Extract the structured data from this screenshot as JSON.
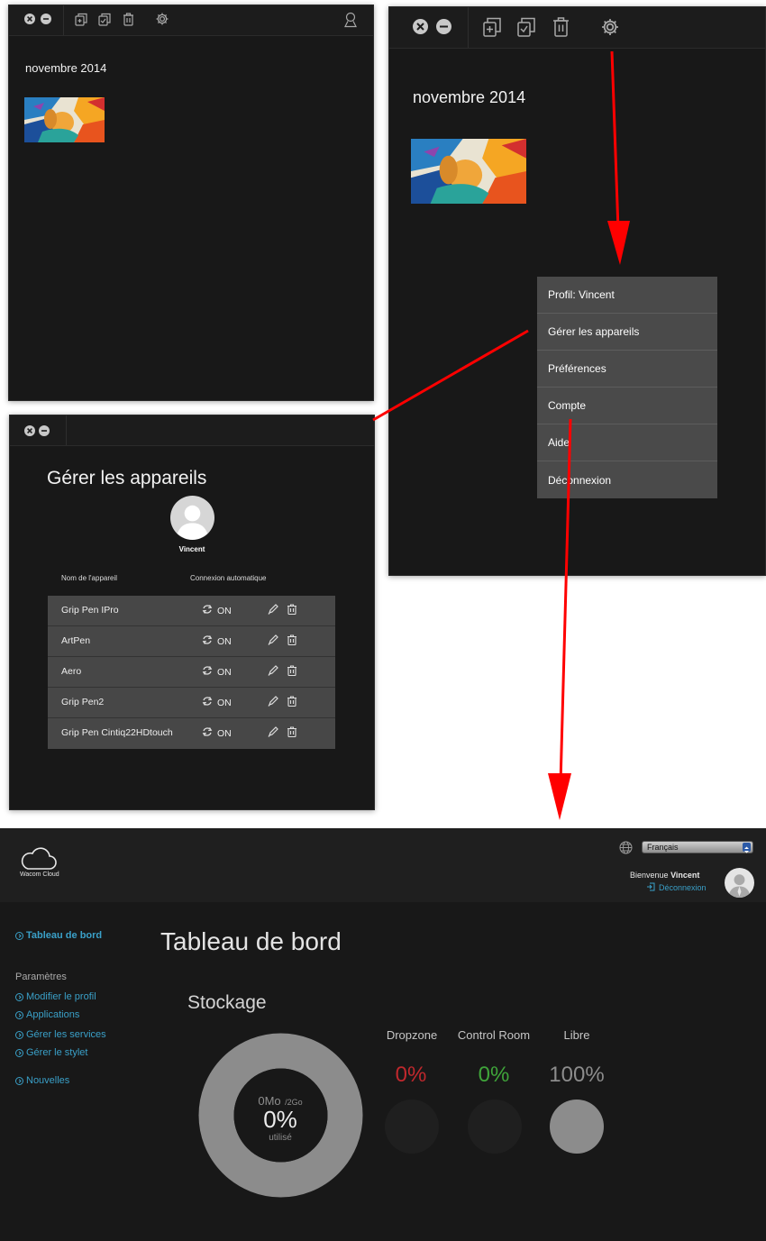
{
  "window_a": {
    "month": "novembre 2014"
  },
  "window_b": {
    "month": "novembre 2014"
  },
  "menu": {
    "items": [
      "Profil: Vincent",
      "Gérer les appareils",
      "Préférences",
      "Compte",
      "Aide",
      "Déconnexion"
    ]
  },
  "devices_window": {
    "title": "Gérer les appareils",
    "user": "Vincent",
    "col_name": "Nom de l'appareil",
    "col_connection": "Connexion automatique",
    "rows": [
      {
        "name": "Grip Pen IPro",
        "status": "ON"
      },
      {
        "name": "ArtPen",
        "status": "ON"
      },
      {
        "name": "Aero",
        "status": "ON"
      },
      {
        "name": "Grip Pen2",
        "status": "ON"
      },
      {
        "name": "Grip Pen Cintiq22HDtouch",
        "status": "ON"
      }
    ]
  },
  "dashboard": {
    "logo_text": "Wacom Cloud",
    "language": "Français",
    "welcome_prefix": "Bienvenue",
    "welcome_user": "Vincent",
    "logout": "Déconnexion",
    "sidebar": {
      "active": "Tableau de bord",
      "section_title": "Paramètres",
      "links": [
        "Modifier le profil",
        "Applications",
        "Gérer les services",
        "Gérer le stylet"
      ],
      "news": "Nouvelles"
    },
    "page_title": "Tableau de bord",
    "storage_title": "Stockage",
    "donut": {
      "used": "0Mo",
      "total": "/2Go",
      "percent": "0%",
      "caption": "utilisé"
    },
    "stats": [
      {
        "label": "Dropzone",
        "value": "0%",
        "color": "#c0282d"
      },
      {
        "label": "Control Room",
        "value": "0%",
        "color": "#3fa43a"
      },
      {
        "label": "Libre",
        "value": "100%",
        "color": "#8c8c8c"
      }
    ]
  },
  "colors": {
    "accent": "#3aa0c8",
    "arrow": "#ff0000",
    "menu_bg": "#4a4a4a",
    "window_bg": "#181818"
  }
}
